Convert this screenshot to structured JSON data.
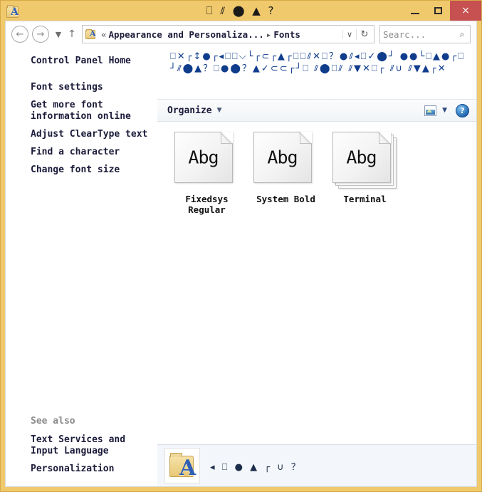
{
  "window": {
    "title_symbols": "⎕ ⫽ ⬤ ▲ ?",
    "app_icon_letter": "A",
    "minimize_label": "Minimize",
    "maximize_label": "Maximize",
    "close_label": "×"
  },
  "addressbar": {
    "back_glyph": "←",
    "forward_glyph": "→",
    "recent_glyph": "▼",
    "up_glyph": "↑",
    "breadcrumb_prefix": "«",
    "breadcrumb_parent": "Appearance and Personaliza...",
    "breadcrumb_sep": "▸",
    "breadcrumb_current": "Fonts",
    "dropdown_glyph": "∨",
    "refresh_glyph": "↻",
    "search_placeholder": "Searc...",
    "search_value": "",
    "search_icon_glyph": "⌕"
  },
  "navpane": {
    "items": [
      {
        "label": "Control Panel Home"
      },
      {
        "label": "Font settings"
      },
      {
        "label": "Get more font information online"
      },
      {
        "label": "Adjust ClearType text"
      },
      {
        "label": "Find a character"
      },
      {
        "label": "Change font size"
      }
    ],
    "see_also_title": "See also",
    "see_also_items": [
      {
        "label": "Text Services and Input Language"
      },
      {
        "label": "Personalization"
      }
    ]
  },
  "content": {
    "header_symbols": "⎕✕┌↕●┌◂⎕⎕⌵└┌⊂┌▲┌⎕⎕⫽✕⎕？●⫽◂⎕✓⬤┘ ●●└⎕▲●┌⎕┘⫽⬤▲？⎕●⬤？▲✓⊂⊂┌┘⎕ ⫽⬤⎕⫽ ⫽▼✕⎕┌ ⫽∪ ⫽▼▲┌✕",
    "toolbar": {
      "organize_label": "Organize",
      "organize_caret": "▼",
      "view_caret": "▼",
      "help_glyph": "?"
    },
    "items": [
      {
        "name": "Fixedsys Regular",
        "preview": "Abg",
        "stacked": false
      },
      {
        "name": "System Bold",
        "preview": "Abg",
        "stacked": false
      },
      {
        "name": "Terminal",
        "preview": "Abg",
        "stacked": true
      }
    ]
  },
  "statusbar": {
    "icon_letter": "A",
    "text_symbols": "◂ ⎕ ● ▲ ┌ ∪ ？"
  }
}
